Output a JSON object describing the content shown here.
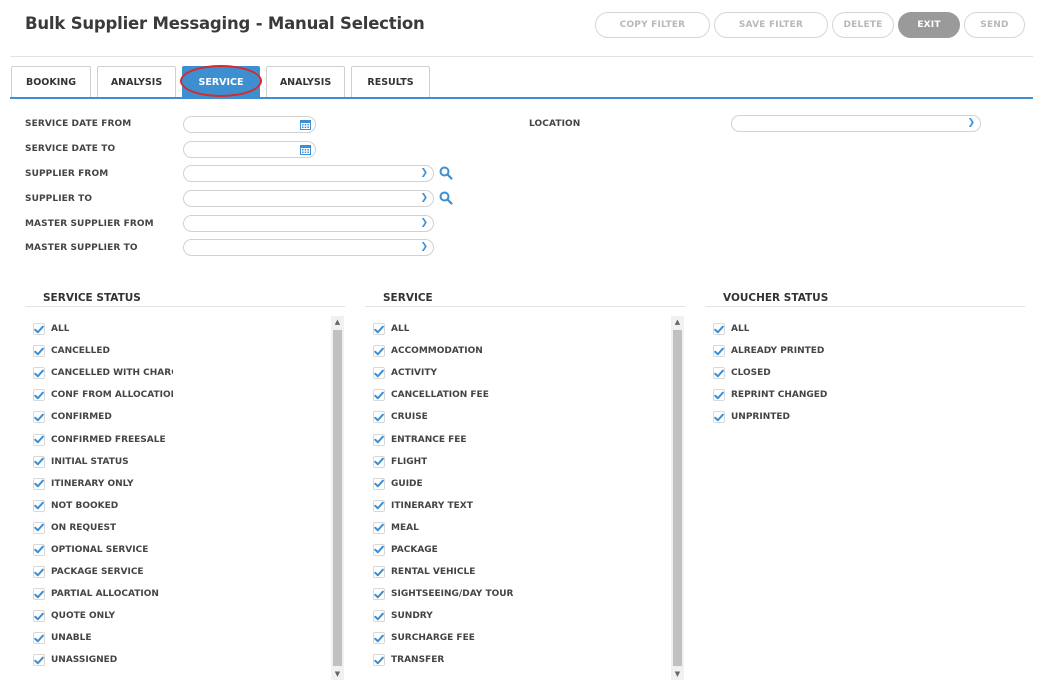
{
  "page": {
    "title": "Bulk Supplier Messaging - Manual Selection"
  },
  "toolbar": {
    "copy_filter": "COPY FILTER",
    "save_filter": "SAVE FILTER",
    "delete": "DELETE",
    "exit": "EXIT",
    "send": "SEND"
  },
  "tabs": [
    {
      "label": "BOOKING"
    },
    {
      "label": "ANALYSIS"
    },
    {
      "label": "SERVICE"
    },
    {
      "label": "ANALYSIS"
    },
    {
      "label": "RESULTS"
    }
  ],
  "form": {
    "service_date_from": "SERVICE DATE FROM",
    "service_date_to": "SERVICE DATE TO",
    "supplier_from": "SUPPLIER FROM",
    "supplier_to": "SUPPLIER TO",
    "master_supplier_from": "MASTER SUPPLIER FROM",
    "master_supplier_to": "MASTER SUPPLIER TO",
    "location": "LOCATION"
  },
  "service_status": {
    "title": "SERVICE STATUS",
    "items": [
      "ALL",
      "CANCELLED",
      "CANCELLED WITH CHARG",
      "CONF FROM ALLOCATIOI",
      "CONFIRMED",
      "CONFIRMED FREESALE",
      "INITIAL STATUS",
      "ITINERARY ONLY",
      "NOT BOOKED",
      "ON REQUEST",
      "OPTIONAL SERVICE",
      "PACKAGE SERVICE",
      "PARTIAL ALLOCATION",
      "QUOTE ONLY",
      "UNABLE",
      "UNASSIGNED"
    ]
  },
  "service": {
    "title": "SERVICE",
    "items": [
      "ALL",
      "ACCOMMODATION",
      "ACTIVITY",
      "CANCELLATION FEE",
      "CRUISE",
      "ENTRANCE FEE",
      "FLIGHT",
      "GUIDE",
      "ITINERARY TEXT",
      "MEAL",
      "PACKAGE",
      "RENTAL VEHICLE",
      "SIGHTSEEING/DAY TOUR",
      "SUNDRY",
      "SURCHARGE FEE",
      "TRANSFER"
    ]
  },
  "voucher_status": {
    "title": "VOUCHER STATUS",
    "items": [
      "ALL",
      "ALREADY PRINTED",
      "CLOSED",
      "REPRINT CHANGED",
      "UNPRINTED"
    ]
  },
  "colors": {
    "accent": "#3d8fd1",
    "highlight_ring": "#d42b2b",
    "exit_button": "#9a9a9a"
  },
  "icons": {
    "date": "calendar-icon",
    "dropdown": "chevron-down-icon",
    "lookup": "search-icon",
    "check": "checkmark-icon"
  }
}
